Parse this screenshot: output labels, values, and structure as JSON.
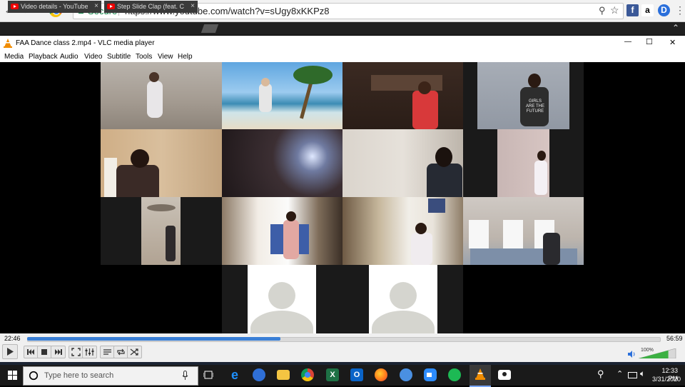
{
  "browser": {
    "secure_label": "Secure",
    "url": "https://www.youtube.com/watch?v=sUgy8xKKPz8",
    "tabs": [
      {
        "label": "Video details - YouTube",
        "close": "×"
      },
      {
        "label": "Step Slide Clap (feat. Chr",
        "close": "×"
      }
    ],
    "extensions": {
      "facebook": "f",
      "amazon": "a",
      "d": "D"
    },
    "icons": {
      "back": "back-arrow-icon",
      "forward": "forward-arrow-icon",
      "reload": "reload-icon",
      "chrome": "chrome-logo-icon",
      "zoom": "zoom-icon",
      "star": "star-icon",
      "menu": "kebab-menu-icon",
      "collapse": "chevron-up-icon"
    }
  },
  "vlc": {
    "title": "FAA Dance class 2.mp4 - VLC media player",
    "menu": [
      "Media",
      "Playback",
      "Audio",
      "Video",
      "Subtitle",
      "Tools",
      "View",
      "Help"
    ],
    "window_controls": {
      "minimize": "—",
      "maximize": "☐",
      "close": "✕"
    },
    "elapsed": "22:46",
    "total": "56:59",
    "progress_fraction": 0.4,
    "volume_label": "100%",
    "volume_fraction": 0.8,
    "video_overlay": {
      "shirt_text_1": "GIRLS",
      "shirt_text_2": "ARE THE",
      "shirt_text_3": "FUTURE"
    }
  },
  "taskbar": {
    "search_placeholder": "Type here to search",
    "time": "12:33 PM",
    "date": "3/31/2020"
  },
  "colors": {
    "accent": "#3a7fd6",
    "vlc_orange": "#f08c00",
    "secure_green": "#0b8043"
  }
}
